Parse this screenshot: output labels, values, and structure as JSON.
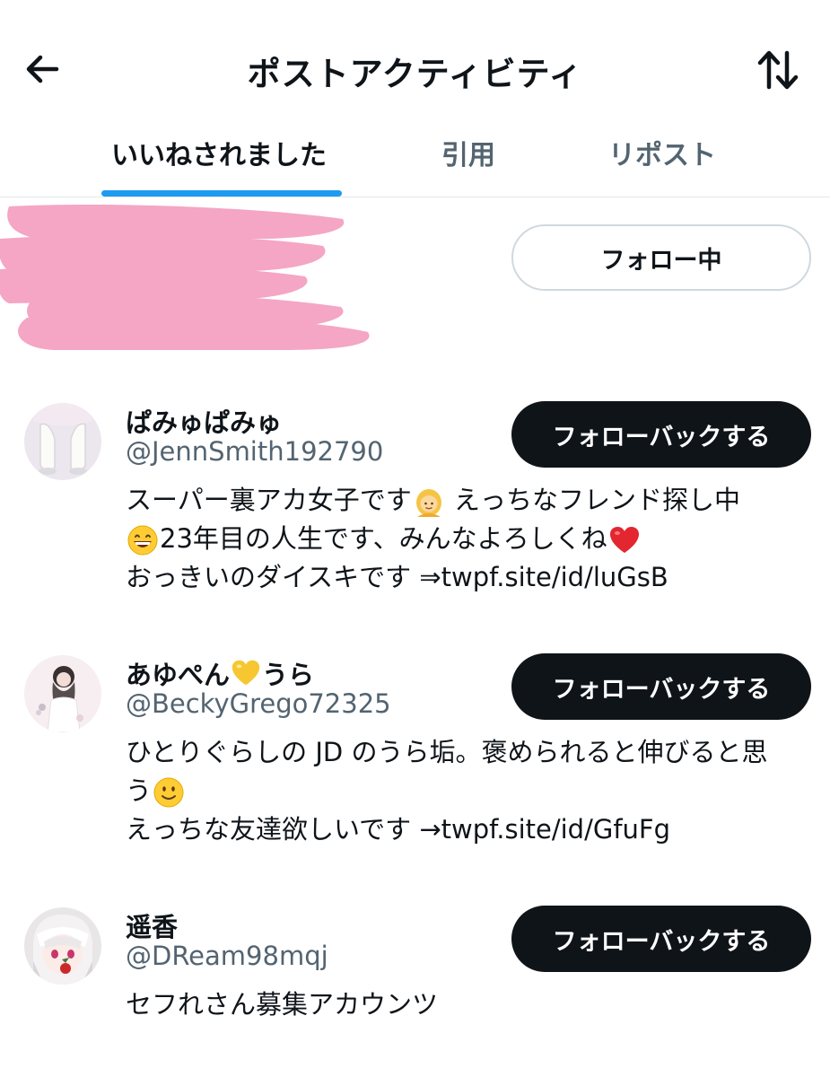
{
  "header": {
    "title": "ポストアクティビティ",
    "back_icon": "arrow-left-icon",
    "sort_icon": "sort-arrows-icon"
  },
  "tabs": [
    {
      "label": "いいねされました",
      "active": true
    },
    {
      "label": "引用",
      "active": false
    },
    {
      "label": "リポスト",
      "active": false
    }
  ],
  "redacted_user": {
    "follow_label": "フォロー中"
  },
  "users": [
    {
      "name": "ぱみゅぱみゅ",
      "handle": "@JennSmith192790",
      "button_label": "フォローバックする",
      "bio_lines": [
        "スーパー裏アカ女子です",
        "えっちなフレンド探し中",
        "23年目の人生です、みんなよろしくね",
        "おっきいのダイスキです ⇒twpf.site/id/luGsB"
      ]
    },
    {
      "name_prefix": "あゆぺん",
      "name_suffix": "うら",
      "handle": "@BeckyGrego72325",
      "button_label": "フォローバックする",
      "bio_lines": [
        "ひとりぐらしの JD のうら垢。褒められると伸びると思",
        "う",
        "えっちな友達欲しいです →twpf.site/id/GfuFg"
      ]
    },
    {
      "name": "遥香",
      "handle": "@DReam98mqj",
      "button_label": "フォローバックする",
      "bio_lines": [
        "セフれさん募集アカウンツ"
      ]
    }
  ],
  "colors": {
    "accent": "#1d9bf0",
    "text": "#0f1419",
    "muted": "#536471",
    "redaction": "#f4a6c4"
  }
}
